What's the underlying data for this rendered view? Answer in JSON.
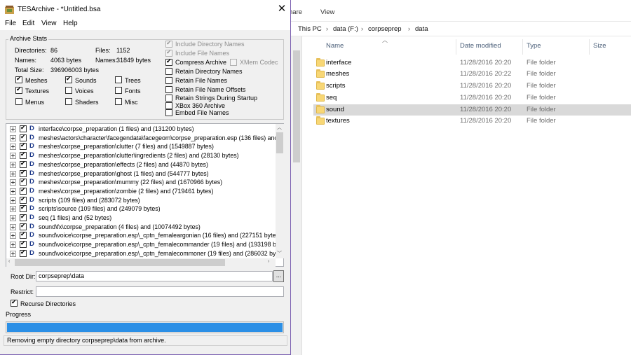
{
  "explorer": {
    "ribbon_tabs": [
      "hare",
      "View"
    ],
    "breadcrumb": [
      "This PC",
      "data (F:)",
      "corpseprep",
      "data"
    ],
    "columns": {
      "name": "Name",
      "date": "Date modified",
      "type": "Type",
      "size": "Size"
    },
    "rows": [
      {
        "name": "interface",
        "date": "11/28/2016 20:20",
        "type": "File folder"
      },
      {
        "name": "meshes",
        "date": "11/28/2016 20:22",
        "type": "File folder"
      },
      {
        "name": "scripts",
        "date": "11/28/2016 20:20",
        "type": "File folder"
      },
      {
        "name": "seq",
        "date": "11/28/2016 20:20",
        "type": "File folder"
      },
      {
        "name": "sound",
        "date": "11/28/2016 20:20",
        "type": "File folder"
      },
      {
        "name": "textures",
        "date": "11/28/2016 20:20",
        "type": "File folder"
      }
    ],
    "selected_row": "sound"
  },
  "app": {
    "title": "TESArchive - *Untitled.bsa",
    "close_glyph": "✕",
    "menu": [
      "File",
      "Edit",
      "View",
      "Help"
    ]
  },
  "stats": {
    "legend": "Archive Stats",
    "directories_label": "Directories:",
    "directories_value": "86",
    "files_label": "Files:",
    "files_value": "1152",
    "names_label": "Names:",
    "names_value": "4063 bytes",
    "names2_label": "Names:",
    "names2_value": "31849 bytes",
    "total_label": "Total Size:",
    "total_value": "396906003 bytes"
  },
  "types": [
    {
      "label": "Meshes",
      "checked": true
    },
    {
      "label": "Textures",
      "checked": true
    },
    {
      "label": "Menus",
      "checked": false
    },
    {
      "label": "Sounds",
      "checked": true
    },
    {
      "label": "Voices",
      "checked": false
    },
    {
      "label": "Shaders",
      "checked": false
    },
    {
      "label": "Trees",
      "checked": false
    },
    {
      "label": "Fonts",
      "checked": false
    },
    {
      "label": "Misc",
      "checked": false
    }
  ],
  "options": {
    "include_dir_names": {
      "label": "Include Directory Names",
      "checked": true,
      "disabled": true
    },
    "include_file_names": {
      "label": "Include File Names",
      "checked": true,
      "disabled": true
    },
    "compress_archive": {
      "label": "Compress Archive",
      "checked": true,
      "disabled": false
    },
    "xmem_codec": {
      "label": "XMem Codec",
      "checked": false,
      "disabled": true
    },
    "retain_dir_names": {
      "label": "Retain Directory Names",
      "checked": false,
      "disabled": false
    },
    "retain_file_names": {
      "label": "Retain File Names",
      "checked": false,
      "disabled": false
    },
    "retain_file_offsets": {
      "label": "Retain File Name Offsets",
      "checked": false,
      "disabled": false
    },
    "retain_strings": {
      "label": "Retain Strings During Startup",
      "checked": false,
      "disabled": false
    },
    "xbox360": {
      "label": "XBox 360 Archive",
      "checked": false,
      "disabled": false
    },
    "embed_file_names": {
      "label": "Embed File Names",
      "checked": false,
      "disabled": false
    }
  },
  "tree": {
    "dir_icon_glyph": "D",
    "items": [
      "interface\\corpse_preparation (1 files) and (131200 bytes)",
      "meshes\\actors\\character\\facegendata\\facegeom\\corpse_preparation.esp (136 files) and",
      "meshes\\corpse_preparation\\clutter (7 files) and (1549887 bytes)",
      "meshes\\corpse_preparation\\clutter\\ingredients (2 files) and (28130 bytes)",
      "meshes\\corpse_preparation\\effects (2 files) and (44870 bytes)",
      "meshes\\corpse_preparation\\ghost (1 files) and (544777 bytes)",
      "meshes\\corpse_preparation\\mummy (22 files) and (1670966 bytes)",
      "meshes\\corpse_preparation\\zombie (2 files) and (719461 bytes)",
      "scripts (109 files) and (283072 bytes)",
      "scripts\\source (109 files) and (249079 bytes)",
      "seq (1 files) and (52 bytes)",
      "sound\\fx\\corpse_preparation (4 files) and (10074492 bytes)",
      "sound\\voice\\corpse_preparation.esp\\_cptn_femaleargonian (16 files) and (227151 bytes",
      "sound\\voice\\corpse_preparation.esp\\_cptn_femalecommander (19 files) and (193198 by",
      "sound\\voice\\corpse_preparation.esp\\_cptn_femalecommoner (19 files) and (286032 byt"
    ]
  },
  "root_dir": {
    "label": "Root Dir:",
    "value": "corpseprep\\data",
    "browse_label": "..."
  },
  "restrict": {
    "label": "Restrict:",
    "value": ""
  },
  "recurse": {
    "label": "Recurse Directories",
    "checked": true
  },
  "progress": {
    "label": "Progress",
    "fraction": 1.0,
    "color": "#2b8fe6"
  },
  "status_text": "Removing empty directory corpseprep\\data from archive."
}
